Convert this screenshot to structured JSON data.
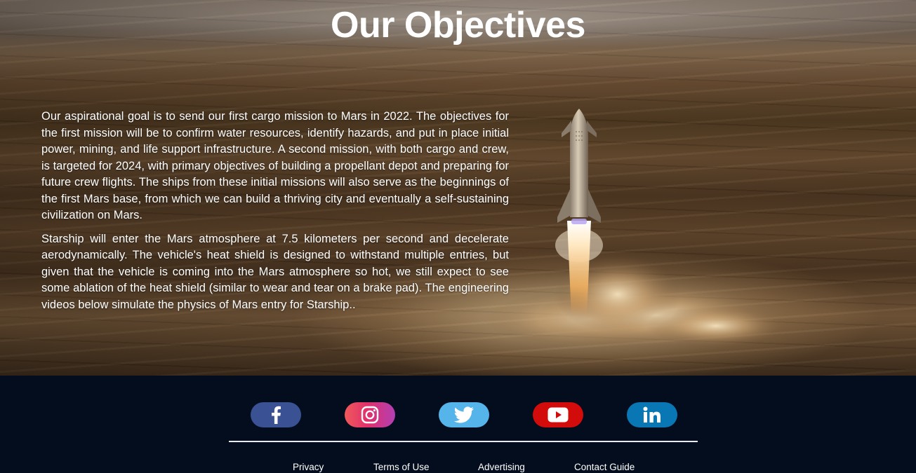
{
  "hero": {
    "title": "Our Objectives",
    "paragraphs": [
      "Our aspirational goal is to send our first cargo mission to Mars in 2022. The objectives for the first mission will be to confirm water resources, identify hazards, and put in place initial power, mining, and life support infrastructure. A second mission, with both cargo and crew, is targeted for 2024, with primary objectives of building a propellant depot and preparing for future crew flights. The ships from these initial missions will also serve as the beginnings of the first Mars base, from which we can build a thriving city and eventually a self-sustaining civilization on Mars.",
      "Starship will enter the Mars atmosphere at 7.5 kilometers per second and decelerate aerodynamically. The vehicle's heat shield is designed to withstand multiple entries, but given that the vehicle is coming into the Mars atmosphere so hot, we still expect to see some ablation of the heat shield (similar to wear and tear on a brake pad). The engineering videos below simulate the physics of Mars entry for Starship.."
    ]
  },
  "footer": {
    "social": [
      {
        "icon": "facebook-icon",
        "color": "#3a5294"
      },
      {
        "icon": "instagram-icon",
        "color": "#e1306c"
      },
      {
        "icon": "twitter-icon",
        "color": "#55b4ea"
      },
      {
        "icon": "youtube-icon",
        "color": "#d20b0b"
      },
      {
        "icon": "linkedin-icon",
        "color": "#0a77b5"
      }
    ],
    "links": [
      "Privacy",
      "Terms of Use",
      "Advertising",
      "Contact Guide"
    ]
  },
  "colors": {
    "footer_background": "#040d1d",
    "text": "#ffffff"
  }
}
